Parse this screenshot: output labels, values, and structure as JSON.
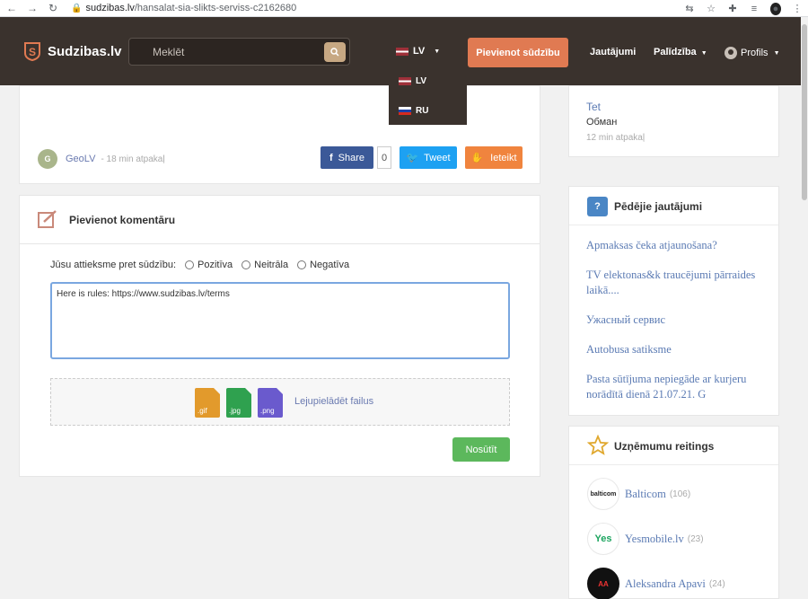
{
  "browser": {
    "url_host": "sudzibas.lv",
    "url_path": "/hansalat-sia-slikts-serviss-c2162680"
  },
  "header": {
    "brand": "Sudzibas.lv",
    "search_placeholder": "Meklēt",
    "lang_current": "LV",
    "cta": "Pievienot sūdzību",
    "nav_questions": "Jautājumi",
    "nav_help": "Palīdzība",
    "nav_profile": "Profils"
  },
  "lang_dropdown": {
    "options": [
      "LV",
      "RU"
    ]
  },
  "post": {
    "author_initial": "G",
    "author": "GeoLV",
    "time": "18 min atpakaļ",
    "share_label": "Share",
    "share_count": "0",
    "tweet_label": "Tweet",
    "report_label": "Ieteikt"
  },
  "comment_form": {
    "title": "Pievienot komentāru",
    "attitude_label": "Jūsu attieksme pret sūdzību:",
    "options": [
      "Pozitīva",
      "Neitrāla",
      "Negatīva"
    ],
    "text": "Here is rules: https://www.sudzibas.lv/terms",
    "file_types": [
      ".gif",
      ".jpg",
      ".png"
    ],
    "upload_label": "Lejupielādēt failus",
    "submit": "Nosūtīt"
  },
  "sidebar": {
    "recent_answer": {
      "q": "Tet",
      "a": "Обман",
      "time": "12 min atpakaļ"
    },
    "latest_questions_title": "Pēdējie jautājumi",
    "latest_questions": [
      "Apmaksas čeka atjaunošana?",
      "TV elektonas&k traucējumi pārraides laikā....",
      "Ужасный сервис",
      "Autobusa satiksme",
      "Pasta sūtījuma nepiegāde ar kurjeru norādītā dienā 21.07.21. G"
    ],
    "ratings_title": "Uzņēmumu reitings",
    "companies": [
      {
        "name": "Balticom",
        "count": "(106)",
        "logo": "balticom"
      },
      {
        "name": "Yesmobile.lv",
        "count": "(23)",
        "logo": "Yes"
      },
      {
        "name": "Aleksandra Apavi",
        "count": "(24)",
        "logo": "AA"
      }
    ]
  },
  "colors": {
    "header_bg": "#3a322d",
    "cta": "#e07a52",
    "link": "#5a7ab3"
  }
}
